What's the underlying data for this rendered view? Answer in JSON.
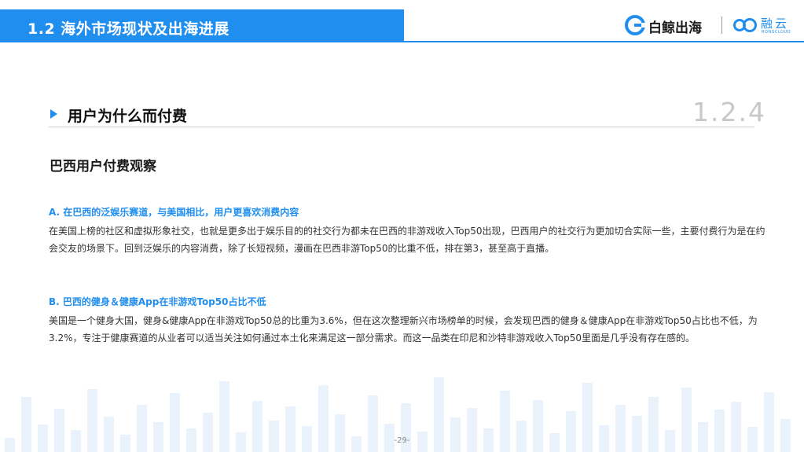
{
  "header": {
    "title": "1.2 海外市场现状及出海进展",
    "brand_name": "白鲸出海",
    "partner_name": "融云",
    "partner_sub": "RONGCLOUD",
    "accent_color": "#1f8eef"
  },
  "section": {
    "title": "用户为什么而付费",
    "number": "1.2.4"
  },
  "subtitle": "巴西用户付费观察",
  "paragraphs": [
    {
      "heading": "A. 在巴西的泛娱乐赛道，与美国相比，用户更喜欢消费内容",
      "body": "在美国上榜的社区和虚拟形象社交，也就是更多出于娱乐目的的社交行为都未在巴西的非游戏收入Top50出现，巴西用户的社交行为更加切合实际一些，主要付费行为是在约会交友的场景下。回到泛娱乐的内容消费，除了长短视频，漫画在巴西非游Top50的比重不低，排在第3，甚至高于直播。"
    },
    {
      "heading": "B. 巴西的健身＆健康App在非游戏Top50占比不低",
      "body": "美国是一个健身大国，健身&健康App在非游戏Top50总的比重为3.6%，但在这次整理新兴市场榜单的时候，会发现巴西的健身＆健康App在非游戏Top50占比也不低，为3.2%，专注于健康赛道的从业者可以适当关注如何通过本土化来满足这一部分需求。而这一品类在印尼和沙特非游戏收入Top50里面是几乎没有存在感的。"
    }
  ],
  "page_number": "-29-"
}
